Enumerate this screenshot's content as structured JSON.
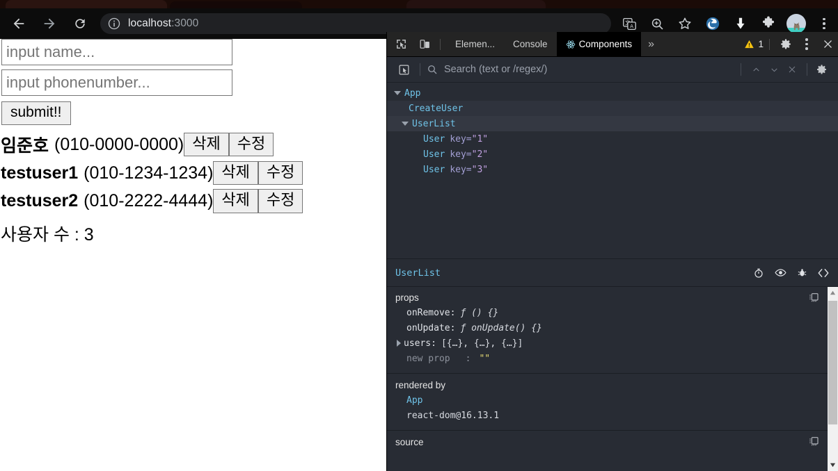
{
  "browser": {
    "nav": {
      "back": "back-arrow",
      "forward": "forward-arrow",
      "reload": "reload"
    },
    "omnibox": {
      "info_icon": "info-circle-icon",
      "host": "localhost",
      "port": ":3000"
    },
    "toolbar_icons": [
      "translate-icon",
      "zoom-icon",
      "bookmark-star-icon",
      "edge-extension-icon",
      "download-icon",
      "puzzle-extension-icon",
      "profile-avatar",
      "kebab-menu-icon"
    ]
  },
  "page": {
    "name_input": {
      "placeholder": "input name...",
      "value": ""
    },
    "phone_input": {
      "placeholder": "input phonenumber...",
      "value": ""
    },
    "submit_label": "submit!!",
    "users": [
      {
        "name": "임준호",
        "phone": "(010-0000-0000)",
        "remove_label": "삭제",
        "update_label": "수정"
      },
      {
        "name": "testuser1",
        "phone": "(010-1234-1234)",
        "remove_label": "삭제",
        "update_label": "수정"
      },
      {
        "name": "testuser2",
        "phone": "(010-2222-4444)",
        "remove_label": "삭제",
        "update_label": "수정"
      }
    ],
    "count_line": "사용자 수 : 3"
  },
  "devtools": {
    "tabs": [
      {
        "label": "Elemen...",
        "active": false,
        "icon": ""
      },
      {
        "label": "Console",
        "active": false,
        "icon": ""
      },
      {
        "label": "Components",
        "active": true,
        "icon": "react-atom-icon"
      }
    ],
    "more_label": "»",
    "warning_count": "1",
    "search": {
      "placeholder": "Search (text or /regex/)",
      "value": ""
    },
    "tree": [
      {
        "label": "App",
        "expandable": true,
        "indent": 0,
        "attr_key": "",
        "attr_val": "",
        "selected": false
      },
      {
        "label": "CreateUser",
        "expandable": false,
        "indent": 1,
        "attr_key": "",
        "attr_val": "",
        "selected": true
      },
      {
        "label": "UserList",
        "expandable": true,
        "indent": 1,
        "attr_key": "",
        "attr_val": "",
        "selected": true
      },
      {
        "label": "User",
        "expandable": false,
        "indent": 2,
        "attr_key": "key=",
        "attr_val": "\"1\"",
        "selected": false
      },
      {
        "label": "User",
        "expandable": false,
        "indent": 2,
        "attr_key": "key=",
        "attr_val": "\"2\"",
        "selected": false
      },
      {
        "label": "User",
        "expandable": false,
        "indent": 2,
        "attr_key": "key=",
        "attr_val": "\"3\"",
        "selected": false
      }
    ],
    "selected_component": "UserList",
    "selected_icons": [
      "timer-icon",
      "eye-icon",
      "bug-icon",
      "code-brackets-icon"
    ],
    "props_section": {
      "title": "props",
      "rows": [
        {
          "key": "onRemove:",
          "value": "ƒ () {}",
          "expandable": false,
          "style": "fn"
        },
        {
          "key": "onUpdate:",
          "value": "ƒ onUpdate() {}",
          "expandable": false,
          "style": "fn"
        },
        {
          "key": "users:",
          "value": "[{…}, {…}, {…}]",
          "expandable": true,
          "style": "val"
        },
        {
          "key": "new prop",
          "value": "\"\"",
          "expandable": false,
          "style": "new"
        }
      ],
      "new_prop_sep": ":"
    },
    "rendered_by_section": {
      "title": "rendered by",
      "entries": [
        {
          "label": "App",
          "link": true
        },
        {
          "label": "react-dom@16.13.1",
          "link": false
        }
      ]
    },
    "source_section": {
      "title": "source"
    }
  }
}
